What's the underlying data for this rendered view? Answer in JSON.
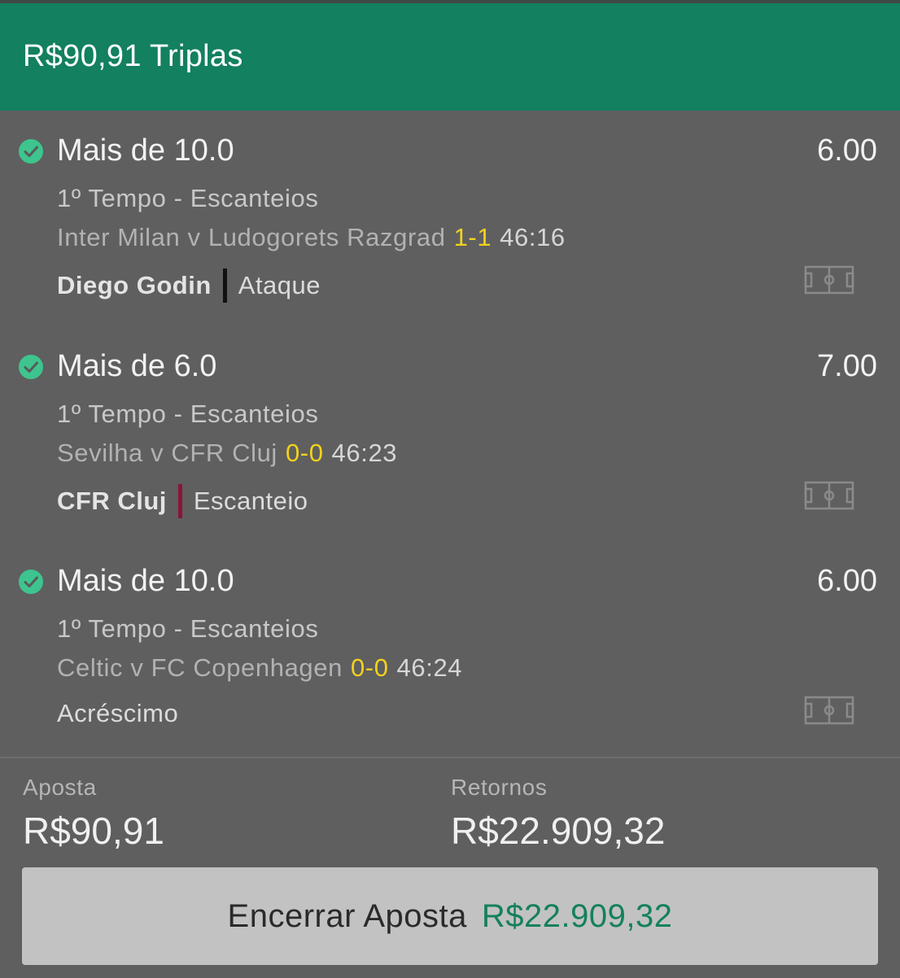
{
  "header": {
    "title": "R$90,91 Triplas"
  },
  "selections": [
    {
      "name": "Mais de 10.0",
      "odds": "6.00",
      "market": "1º Tempo - Escanteios",
      "event": "Inter Milan v Ludogorets Razgrad",
      "score": "1-1",
      "clock": "46:16",
      "team": "Diego Godin",
      "team_color": "#111111",
      "status": "Ataque"
    },
    {
      "name": "Mais de 6.0",
      "odds": "7.00",
      "market": "1º Tempo - Escanteios",
      "event": "Sevilha v CFR Cluj",
      "score": "0-0",
      "clock": "46:23",
      "team": "CFR Cluj",
      "team_color": "#8a1538",
      "status": "Escanteio"
    },
    {
      "name": "Mais de 10.0",
      "odds": "6.00",
      "market": "1º Tempo - Escanteios",
      "event": "Celtic v FC Copenhagen",
      "score": "0-0",
      "clock": "46:24",
      "team": "",
      "status": "Acréscimo"
    }
  ],
  "footer": {
    "stake_label": "Aposta",
    "stake_value": "R$90,91",
    "returns_label": "Retornos",
    "returns_value": "R$22.909,32",
    "cashout_label": "Encerrar Aposta",
    "cashout_amount": "R$22.909,32"
  },
  "colors": {
    "header_bg": "#138060",
    "check": "#3ec48f",
    "score": "#f2d21b",
    "cashout_amount": "#14805e"
  },
  "icons": {
    "check": "check-circle-icon",
    "pitch": "football-pitch-icon"
  }
}
